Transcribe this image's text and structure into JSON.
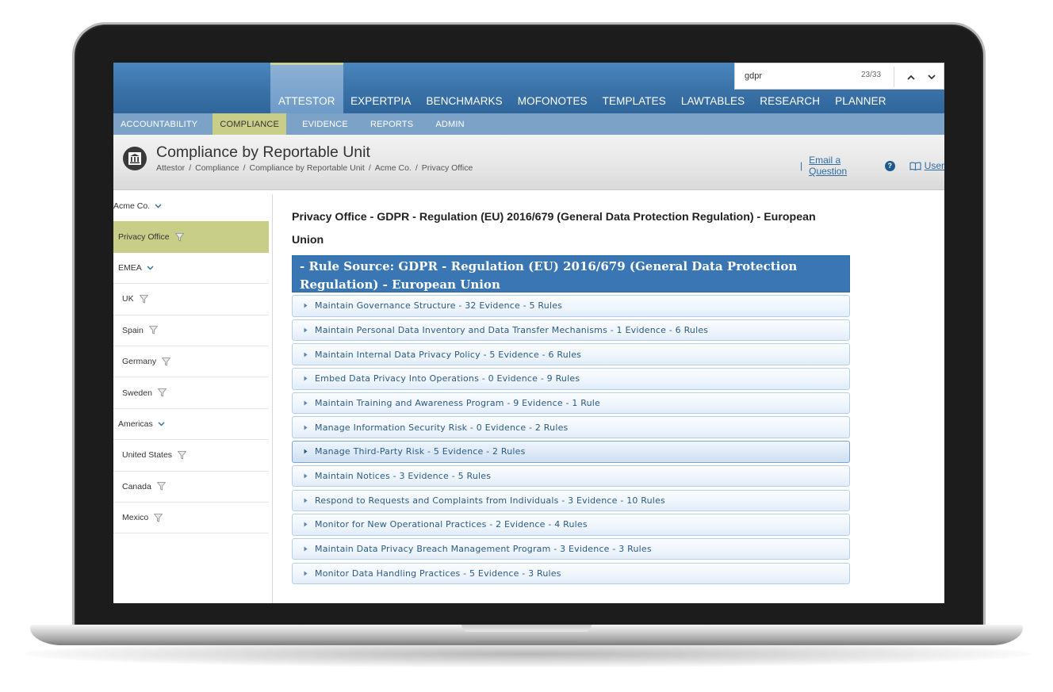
{
  "nav": {
    "tabs": [
      {
        "label": "ATTESTOR",
        "active": true
      },
      {
        "label": "EXPERTPIA",
        "active": false
      },
      {
        "label": "BENCHMARKS",
        "active": false
      },
      {
        "label": "MOFONOTES",
        "active": false
      },
      {
        "label": "TEMPLATES",
        "active": false
      },
      {
        "label": "LAWTABLES",
        "active": false
      },
      {
        "label": "RESEARCH",
        "active": false
      },
      {
        "label": "PLANNER",
        "active": false
      }
    ]
  },
  "search": {
    "value": "gdpr",
    "count": "23/33",
    "prev_icon": "chevron-up-icon",
    "next_icon": "chevron-down-icon"
  },
  "subnav": {
    "tabs": [
      {
        "label": "ACCOUNTABILITY",
        "active": false
      },
      {
        "label": "COMPLIANCE",
        "active": true
      },
      {
        "label": "EVIDENCE",
        "active": false
      },
      {
        "label": "REPORTS",
        "active": false
      },
      {
        "label": "ADMIN",
        "active": false
      }
    ]
  },
  "header": {
    "icon": "bank-icon",
    "title": "Compliance by Reportable Unit",
    "breadcrumb": [
      "Attestor",
      "Compliance",
      "Compliance by Reportable Unit",
      "Acme Co.",
      "Privacy Office"
    ],
    "email_link": "Email a Question",
    "user_link": "User"
  },
  "sidebar": {
    "items": [
      {
        "label": "Acme Co.",
        "icon": "chevron-down-icon",
        "level": 0,
        "active": false
      },
      {
        "label": "Privacy Office",
        "icon": "filter-icon",
        "level": 1,
        "active": true
      },
      {
        "label": "EMEA",
        "icon": "chevron-down-icon",
        "level": 1,
        "active": false
      },
      {
        "label": "UK",
        "icon": "filter-icon",
        "level": 2,
        "active": false
      },
      {
        "label": "Spain",
        "icon": "filter-icon",
        "level": 2,
        "active": false
      },
      {
        "label": "Germany",
        "icon": "filter-icon",
        "level": 2,
        "active": false
      },
      {
        "label": "Sweden",
        "icon": "filter-icon",
        "level": 2,
        "active": false
      },
      {
        "label": "Americas",
        "icon": "chevron-down-icon",
        "level": 1,
        "active": false
      },
      {
        "label": "United States",
        "icon": "filter-icon",
        "level": 2,
        "active": false
      },
      {
        "label": "Canada",
        "icon": "filter-icon",
        "level": 2,
        "active": false
      },
      {
        "label": "Mexico",
        "icon": "filter-icon",
        "level": 2,
        "active": false
      }
    ]
  },
  "main": {
    "heading": "Privacy Office - GDPR - Regulation (EU) 2016/679 (General Data Protection Regulation) - European Union",
    "rule_source": "- Rule Source: GDPR - Regulation (EU) 2016/679 (General Data Protection Regulation) - European Union",
    "rules": [
      {
        "label": "Maintain Governance Structure - 32 Evidence - 5 Rules",
        "highlight": false
      },
      {
        "label": "Maintain Personal Data Inventory and Data Transfer Mechanisms - 1 Evidence - 6 Rules",
        "highlight": false
      },
      {
        "label": "Maintain Internal Data Privacy Policy - 5 Evidence - 6 Rules",
        "highlight": false
      },
      {
        "label": "Embed Data Privacy Into Operations - 0 Evidence - 9 Rules",
        "highlight": false
      },
      {
        "label": "Maintain Training and Awareness Program - 9 Evidence - 1 Rule",
        "highlight": false
      },
      {
        "label": "Manage Information Security Risk - 0 Evidence - 2 Rules",
        "highlight": false
      },
      {
        "label": "Manage Third-Party Risk - 5 Evidence - 2 Rules",
        "highlight": true
      },
      {
        "label": "Maintain Notices - 3 Evidence - 5 Rules",
        "highlight": false
      },
      {
        "label": "Respond to Requests and Complaints from Individuals - 3 Evidence - 10 Rules",
        "highlight": false
      },
      {
        "label": "Monitor for New Operational Practices - 2 Evidence - 4 Rules",
        "highlight": false
      },
      {
        "label": "Maintain Data Privacy Breach Management Program - 3 Evidence - 3 Rules",
        "highlight": false
      },
      {
        "label": "Monitor Data Handling Practices - 5 Evidence - 3 Rules",
        "highlight": false
      }
    ]
  },
  "colors": {
    "nav_blue": "#3a72a8",
    "active_green": "#c8ce87",
    "rule_source_blue": "#3a76b4",
    "link_blue": "#2e6da4"
  }
}
